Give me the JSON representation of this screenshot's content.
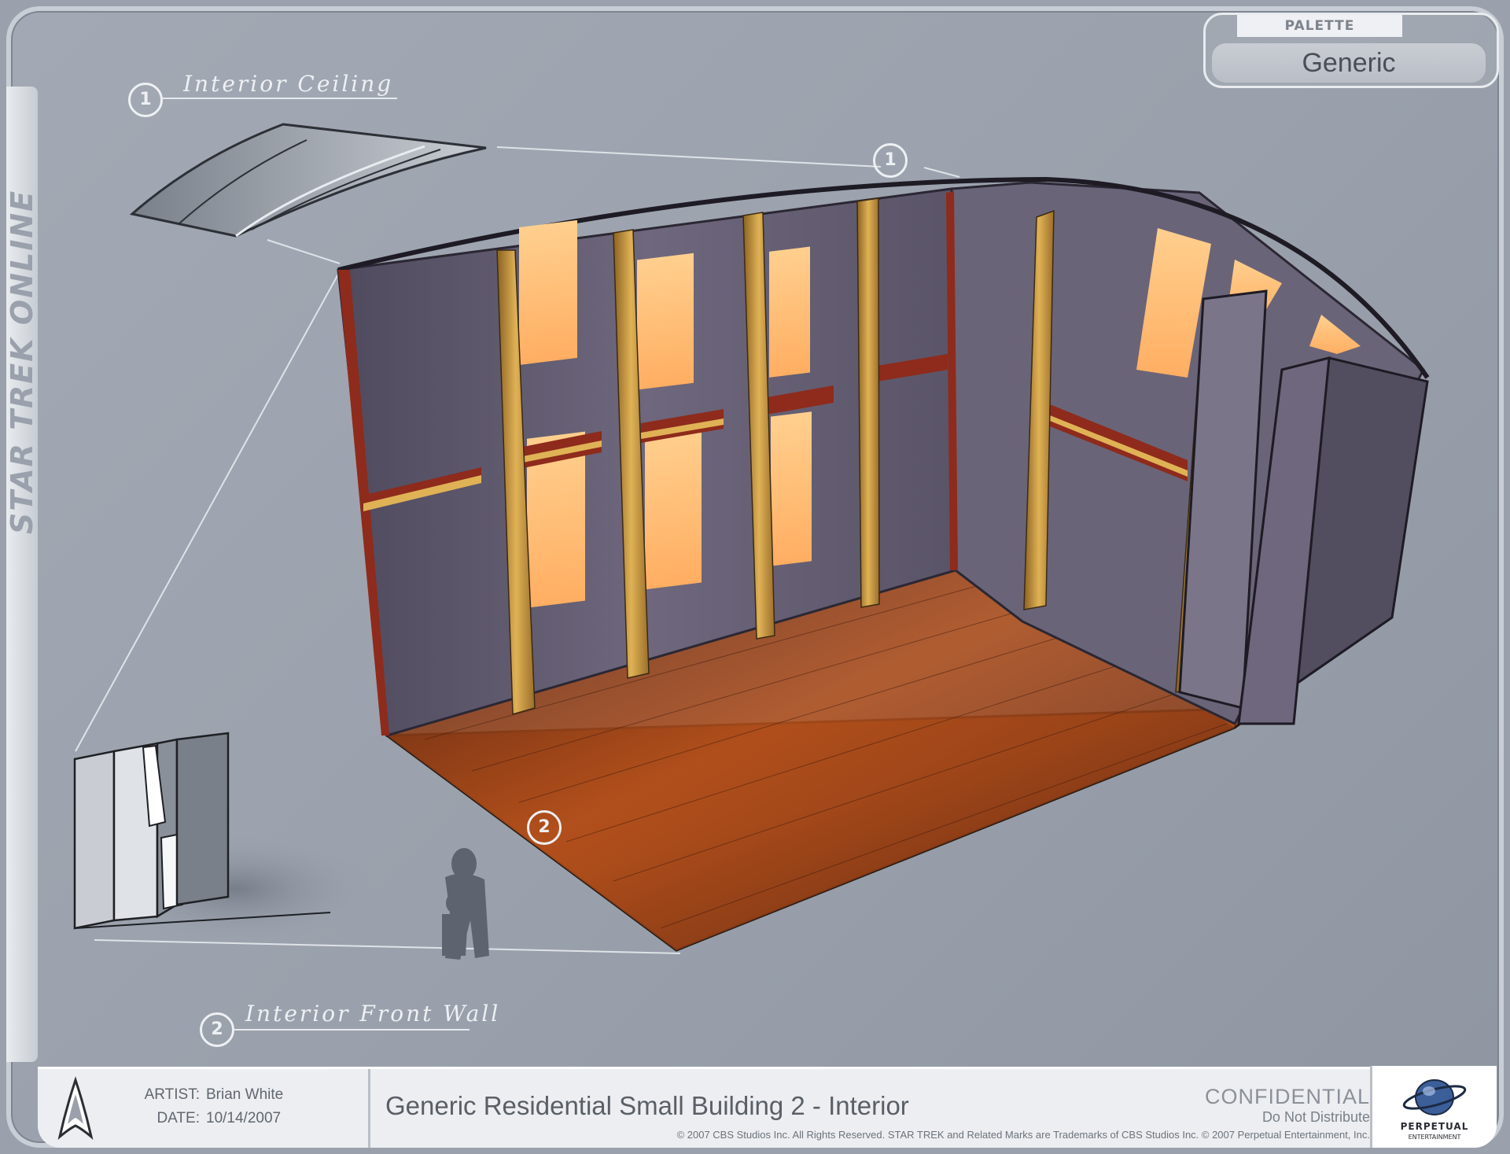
{
  "branding": {
    "game_title": "STAR TREK ONLINE",
    "publisher_logo_line1": "PERPETUAL",
    "publisher_logo_line2": "ENTERTAINMENT",
    "delta_icon": "starfleet-delta-icon",
    "globe_icon": "perpetual-globe-icon"
  },
  "palette": {
    "label": "PALETTE",
    "value": "Generic"
  },
  "callouts": [
    {
      "number": "1",
      "label": "Interior Ceiling"
    },
    {
      "number": "2",
      "label": "Interior Front Wall"
    }
  ],
  "markers": [
    {
      "number": "1"
    },
    {
      "number": "2"
    }
  ],
  "footer": {
    "artist_key": "ARTIST:",
    "artist_value": "Brian White",
    "date_key": "DATE:",
    "date_value": "10/14/2007",
    "sheet_title": "Generic Residential Small Building 2 - Interior",
    "confidential": "CONFIDENTIAL",
    "do_not_distribute": "Do Not Distribute",
    "copyright": "© 2007 CBS Studios Inc. All Rights Reserved. STAR TREK and Related Marks are Trademarks of CBS Studios Inc. © 2007 Perpetual Entertainment, Inc."
  },
  "colors": {
    "background": "#9aa1ac",
    "wall": "#5f5a6e",
    "trim": "#8e2b1c",
    "pillar": "#c9973a",
    "window_glow": "#ffb870",
    "floor": "#8a3512"
  }
}
